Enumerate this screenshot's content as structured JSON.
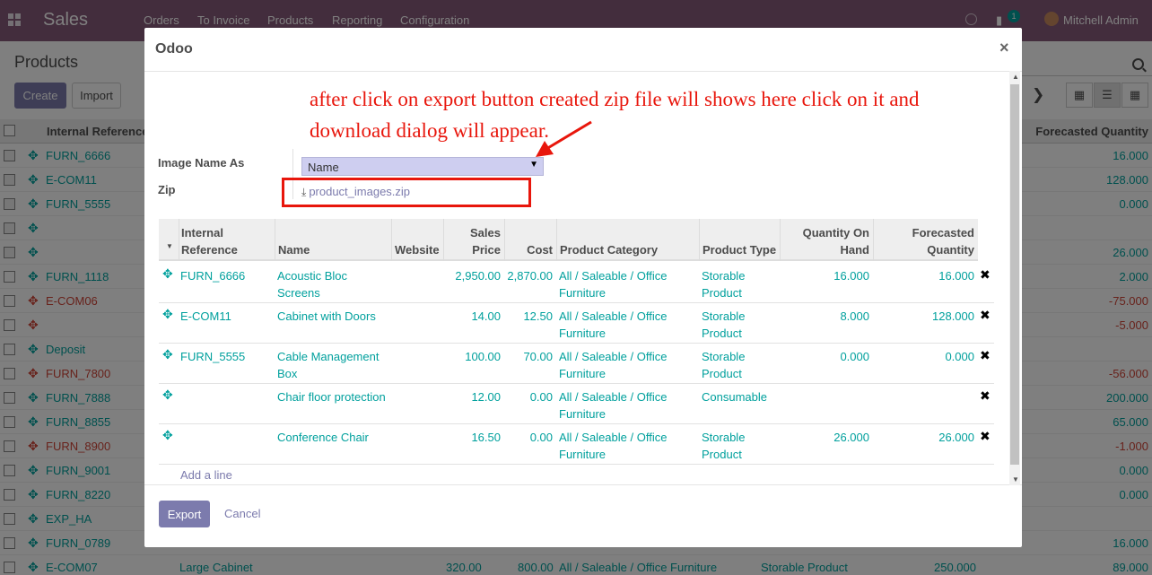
{
  "navbar": {
    "app_name": "Sales",
    "menu": [
      "Orders",
      "To Invoice",
      "Products",
      "Reporting",
      "Configuration"
    ],
    "chat_count": "1",
    "user": "Mitchell Admin",
    "brand_color": "#875a7b"
  },
  "control_panel": {
    "title": "Products",
    "create_label": "Create",
    "import_label": "Import",
    "views": [
      "kanban",
      "list",
      "grid"
    ]
  },
  "background_list": {
    "headers": {
      "internal_reference": "Internal Reference",
      "forecasted_quantity": "Forecasted Quantity"
    },
    "rows": [
      {
        "ref": "FURN_6666",
        "fq": "16.000",
        "checked": true,
        "negative": false
      },
      {
        "ref": "E-COM11",
        "fq": "128.000",
        "checked": true,
        "negative": false
      },
      {
        "ref": "FURN_5555",
        "fq": "0.000",
        "checked": true,
        "negative": false
      },
      {
        "ref": "",
        "fq": "",
        "checked": true,
        "negative": false
      },
      {
        "ref": "",
        "fq": "26.000",
        "checked": true,
        "negative": false
      },
      {
        "ref": "FURN_1118",
        "fq": "2.000",
        "checked": false,
        "negative": false
      },
      {
        "ref": "E-COM06",
        "fq": "-75.000",
        "checked": false,
        "negative": true
      },
      {
        "ref": "",
        "fq": "-5.000",
        "checked": false,
        "negative": true
      },
      {
        "ref": "Deposit",
        "fq": "",
        "checked": false,
        "negative": false
      },
      {
        "ref": "FURN_7800",
        "fq": "-56.000",
        "checked": false,
        "negative": true
      },
      {
        "ref": "FURN_7888",
        "fq": "200.000",
        "checked": false,
        "negative": false
      },
      {
        "ref": "FURN_8855",
        "fq": "65.000",
        "checked": false,
        "negative": false
      },
      {
        "ref": "FURN_8900",
        "fq": "-1.000",
        "checked": false,
        "negative": true
      },
      {
        "ref": "FURN_9001",
        "fq": "0.000",
        "checked": false,
        "negative": false
      },
      {
        "ref": "FURN_8220",
        "fq": "0.000",
        "checked": false,
        "negative": false
      },
      {
        "ref": "EXP_HA",
        "fq": "",
        "checked": false,
        "negative": false
      },
      {
        "ref": "FURN_0789",
        "fq": "16.000",
        "checked": false,
        "negative": false
      },
      {
        "ref": "E-COM07",
        "fq": "89.000",
        "checked": false,
        "negative": false,
        "extra": [
          "Large Cabinet",
          "320.00",
          "800.00",
          "All / Saleable / Office Furniture",
          "Storable Product",
          "250.000"
        ]
      }
    ]
  },
  "dialog": {
    "title": "Odoo",
    "close_glyph": "×",
    "annotation": "after click on export button created zip file will shows here click on it and download dialog will appear.",
    "image_name_label": "Image Name As",
    "image_name_value": "Name",
    "zip_label": "Zip",
    "zip_file": "product_images.zip",
    "table": {
      "headers": {
        "internal_reference": "Internal Reference",
        "name": "Name",
        "website": "Website",
        "sales_price": "Sales Price",
        "cost": "Cost",
        "product_category": "Product Category",
        "product_type": "Product Type",
        "quantity_on_hand": "Quantity On Hand",
        "forecasted_quantity": "Forecasted Quantity"
      },
      "rows": [
        {
          "ref": "FURN_6666",
          "name": "Acoustic Bloc Screens",
          "website": "",
          "price": "2,950.00",
          "cost": "2,870.00",
          "category": "All / Saleable / Office Furniture",
          "type": "Storable Product",
          "qoh": "16.000",
          "fq": "16.000"
        },
        {
          "ref": "E-COM11",
          "name": "Cabinet with Doors",
          "website": "",
          "price": "14.00",
          "cost": "12.50",
          "category": "All / Saleable / Office Furniture",
          "type": "Storable Product",
          "qoh": "8.000",
          "fq": "128.000"
        },
        {
          "ref": "FURN_5555",
          "name": "Cable Management Box",
          "website": "",
          "price": "100.00",
          "cost": "70.00",
          "category": "All / Saleable / Office Furniture",
          "type": "Storable Product",
          "qoh": "0.000",
          "fq": "0.000"
        },
        {
          "ref": "",
          "name": "Chair floor protection",
          "website": "",
          "price": "12.00",
          "cost": "0.00",
          "category": "All / Saleable / Office Furniture",
          "type": "Consumable",
          "qoh": "",
          "fq": ""
        },
        {
          "ref": "",
          "name": "Conference Chair",
          "website": "",
          "price": "16.50",
          "cost": "0.00",
          "category": "All / Saleable / Office Furniture",
          "type": "Storable Product",
          "qoh": "26.000",
          "fq": "26.000"
        }
      ],
      "add_line": "Add a line"
    },
    "export_label": "Export",
    "cancel_label": "Cancel",
    "annotation_color": "#e8160c"
  }
}
